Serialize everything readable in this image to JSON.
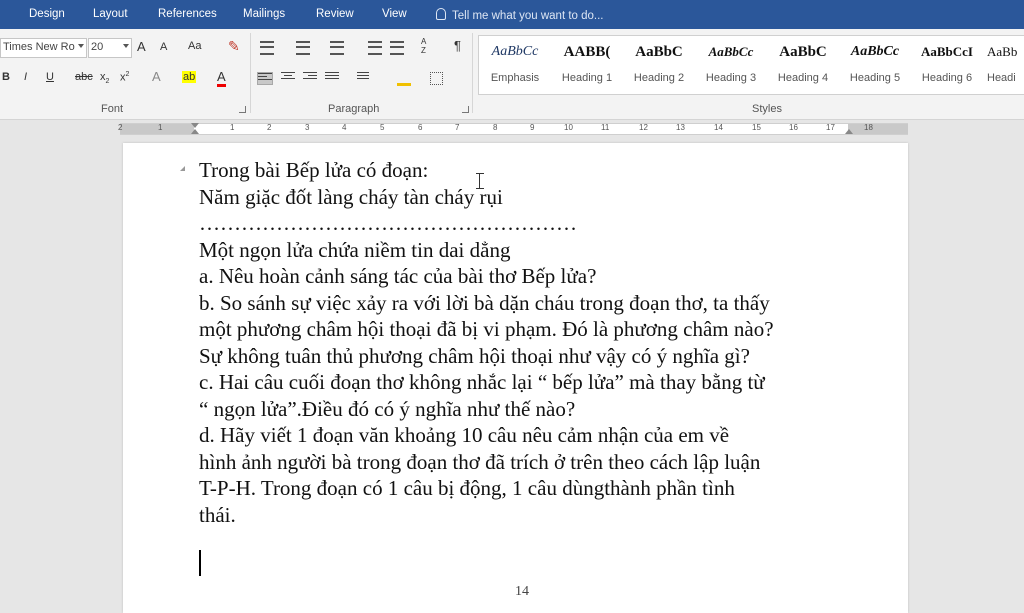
{
  "tabs": [
    "Design",
    "Layout",
    "References",
    "Mailings",
    "Review",
    "View"
  ],
  "tell_me": "Tell me what you want to do...",
  "font": {
    "name": "Times New Ro",
    "size": "20",
    "grow": "A",
    "shrink": "A",
    "case": "Aa",
    "bold": "B",
    "italic": "I",
    "underline": "U",
    "strike": "abc",
    "subscript": "x",
    "superscript": "x",
    "effects": "A",
    "highlight": "ab",
    "color": "A",
    "group_label": "Font"
  },
  "paragraph": {
    "sort": "A Z",
    "pilcrow": "¶",
    "group_label": "Paragraph"
  },
  "styles": {
    "group_label": "Styles",
    "items": [
      {
        "sample": "AaBbCc",
        "name": "Emphasis"
      },
      {
        "sample": "AABB(",
        "name": "Heading 1"
      },
      {
        "sample": "AaBbC",
        "name": "Heading 2"
      },
      {
        "sample": "AaBbCc",
        "name": "Heading 3"
      },
      {
        "sample": "AaBbC",
        "name": "Heading 4"
      },
      {
        "sample": "AaBbCc",
        "name": "Heading 5"
      },
      {
        "sample": "AaBbCcI",
        "name": "Heading 6"
      },
      {
        "sample": "AaBb",
        "name": "Headi"
      }
    ]
  },
  "ruler": {
    "labels": [
      "2",
      "1",
      "1",
      "2",
      "3",
      "4",
      "5",
      "6",
      "7",
      "8",
      "9",
      "10",
      "11",
      "12",
      "13",
      "14",
      "15",
      "16",
      "17",
      "18"
    ]
  },
  "document": {
    "lines": [
      "Trong bài Bếp lửa có đoạn:",
      "Năm giặc đốt làng cháy tàn cháy rụi",
      "………………………………………………",
      "Một ngọn lửa chứa niềm tin dai dẳng",
      "a. Nêu hoàn cảnh sáng tác của bài thơ Bếp lửa?",
      "b. So sánh sự việc  xảy ra với lời bà dặn cháu trong đoạn thơ, ta thấy",
      "một phương châm hội thoại đã bị vi phạm. Đó là phương châm nào?",
      "Sự không tuân thủ phương châm hội thoại như vậy có ý nghĩa gì?",
      "c. Hai câu cuối đoạn thơ không nhắc lại “ bếp lửa” mà thay bằng từ",
      "“ ngọn lửa”.Điều đó có ý nghĩa như thế nào?",
      "d. Hãy  viết 1 đoạn văn khoảng 10 câu  nêu cảm nhận của em về",
      "hình ảnh người bà trong đoạn thơ đã trích ở trên theo cách lập luận",
      "T-P-H. Trong đoạn có 1 câu bị động, 1 câu dùngthành phần tình",
      "thái."
    ],
    "page_number": "14"
  },
  "colors": {
    "title_bar": "#2b579a",
    "ribbon": "#f3f3f3",
    "canvas": "#e6e6e6",
    "heading_style": "#1f3864"
  }
}
